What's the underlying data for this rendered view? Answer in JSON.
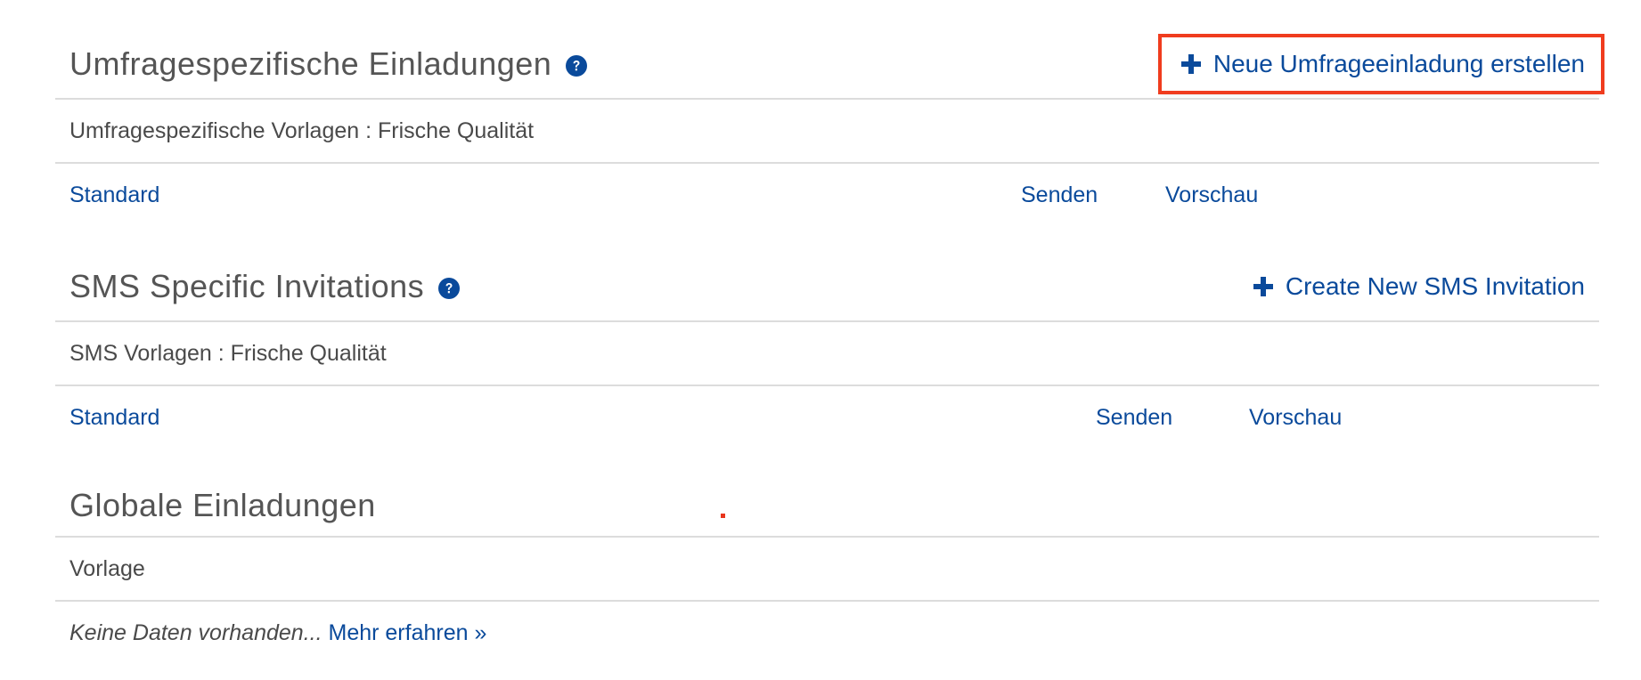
{
  "survey_invitations": {
    "title": "Umfragespezifische Einladungen",
    "create_label": "Neue Umfrageeinladung erstellen",
    "subheader": "Umfragespezifische Vorlagen : Frische Qualität",
    "row": {
      "name": "Standard",
      "send": "Senden",
      "preview": "Vorschau"
    }
  },
  "sms_invitations": {
    "title": "SMS Specific Invitations",
    "create_label": "Create New SMS Invitation",
    "subheader": "SMS Vorlagen : Frische Qualität",
    "row": {
      "name": "Standard",
      "send": "Senden",
      "preview": "Vorschau"
    }
  },
  "global_invitations": {
    "title": "Globale Einladungen",
    "subheader": "Vorlage",
    "empty_text": "Keine Daten vorhanden...",
    "learn_more": "Mehr erfahren »"
  },
  "icons": {
    "help": "question-circle-icon",
    "plus": "plus-icon"
  },
  "colors": {
    "link": "#0a4a9b",
    "highlight": "#f03c1e",
    "divider": "#dcdcdc"
  }
}
